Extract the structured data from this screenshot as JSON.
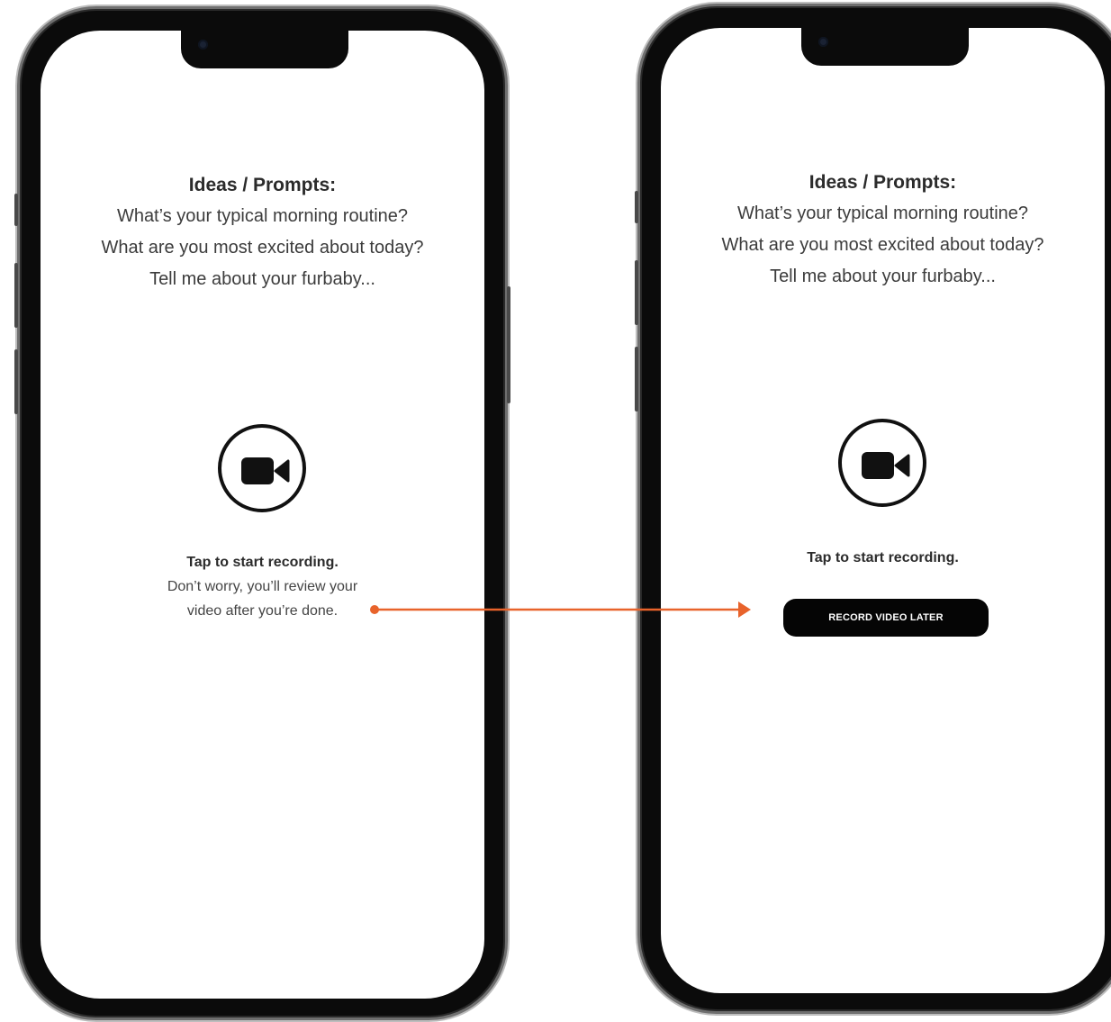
{
  "prompts": {
    "title": "Ideas / Prompts:",
    "lines": [
      "What’s your typical morning routine?",
      "What are you most excited about today?",
      "Tell me about your furbaby..."
    ]
  },
  "left_screen": {
    "tap_text": "Tap to start recording.",
    "reassurance_line1": "Don’t worry, you’ll review your",
    "reassurance_line2": "video after you’re done."
  },
  "right_screen": {
    "tap_text": "Tap to start recording.",
    "record_later_label": "RECORD VIDEO LATER"
  },
  "icons": {
    "record": "video-camera-icon"
  },
  "colors": {
    "annotation_arrow": "#e8632b",
    "button_bg": "#050505",
    "text_primary": "#2b2b2b"
  }
}
